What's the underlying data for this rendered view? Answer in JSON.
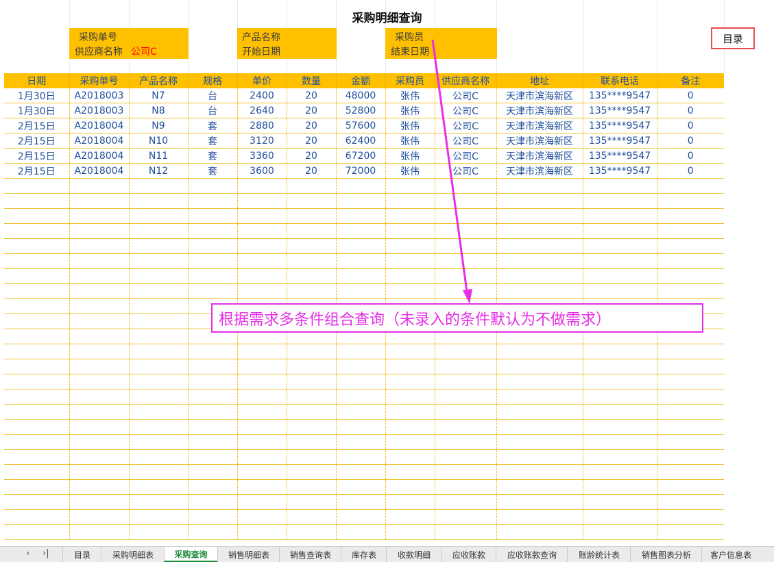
{
  "title": "采购明细查询",
  "criteria": {
    "order_no_label": "采购单号",
    "supplier_label": "供应商名称",
    "supplier_value": "公司C",
    "product_label": "产品名称",
    "start_label": "开始日期",
    "buyer_label": "采购员",
    "end_label": "结束日期"
  },
  "menu_button": "目录",
  "table": {
    "headers": [
      "日期",
      "采购单号",
      "产品名称",
      "规格",
      "单价",
      "数量",
      "金额",
      "采购员",
      "供应商名称",
      "地址",
      "联系电话",
      "备注"
    ],
    "rows": [
      [
        "1月30日",
        "A2018003",
        "N7",
        "台",
        "2400",
        "20",
        "48000",
        "张伟",
        "公司C",
        "天津市滨海新区",
        "135****9547",
        "0"
      ],
      [
        "1月30日",
        "A2018003",
        "N8",
        "台",
        "2640",
        "20",
        "52800",
        "张伟",
        "公司C",
        "天津市滨海新区",
        "135****9547",
        "0"
      ],
      [
        "2月15日",
        "A2018004",
        "N9",
        "套",
        "2880",
        "20",
        "57600",
        "张伟",
        "公司C",
        "天津市滨海新区",
        "135****9547",
        "0"
      ],
      [
        "2月15日",
        "A2018004",
        "N10",
        "套",
        "3120",
        "20",
        "62400",
        "张伟",
        "公司C",
        "天津市滨海新区",
        "135****9547",
        "0"
      ],
      [
        "2月15日",
        "A2018004",
        "N11",
        "套",
        "3360",
        "20",
        "67200",
        "张伟",
        "公司C",
        "天津市滨海新区",
        "135****9547",
        "0"
      ],
      [
        "2月15日",
        "A2018004",
        "N12",
        "套",
        "3600",
        "20",
        "72000",
        "张伟",
        "公司C",
        "天津市滨海新区",
        "135****9547",
        "0"
      ]
    ]
  },
  "annotation": "根据需求多条件组合查询（未录入的条件默认为不做需求）",
  "tabs": {
    "nav_next": "›",
    "nav_last": "›|",
    "items": [
      "目录",
      "采购明细表",
      "采购查询",
      "销售明细表",
      "销售查询表",
      "库存表",
      "收款明细",
      "应收账款",
      "应收账款查询",
      "账龄统计表",
      "销售图表分析",
      "客户信息表"
    ],
    "active": "采购查询"
  },
  "colors": {
    "header_fill": "#ffc000",
    "accent_magenta": "#e62ee6",
    "text_blue": "#1f4e9c",
    "active_tab": "#1e8a3c"
  }
}
